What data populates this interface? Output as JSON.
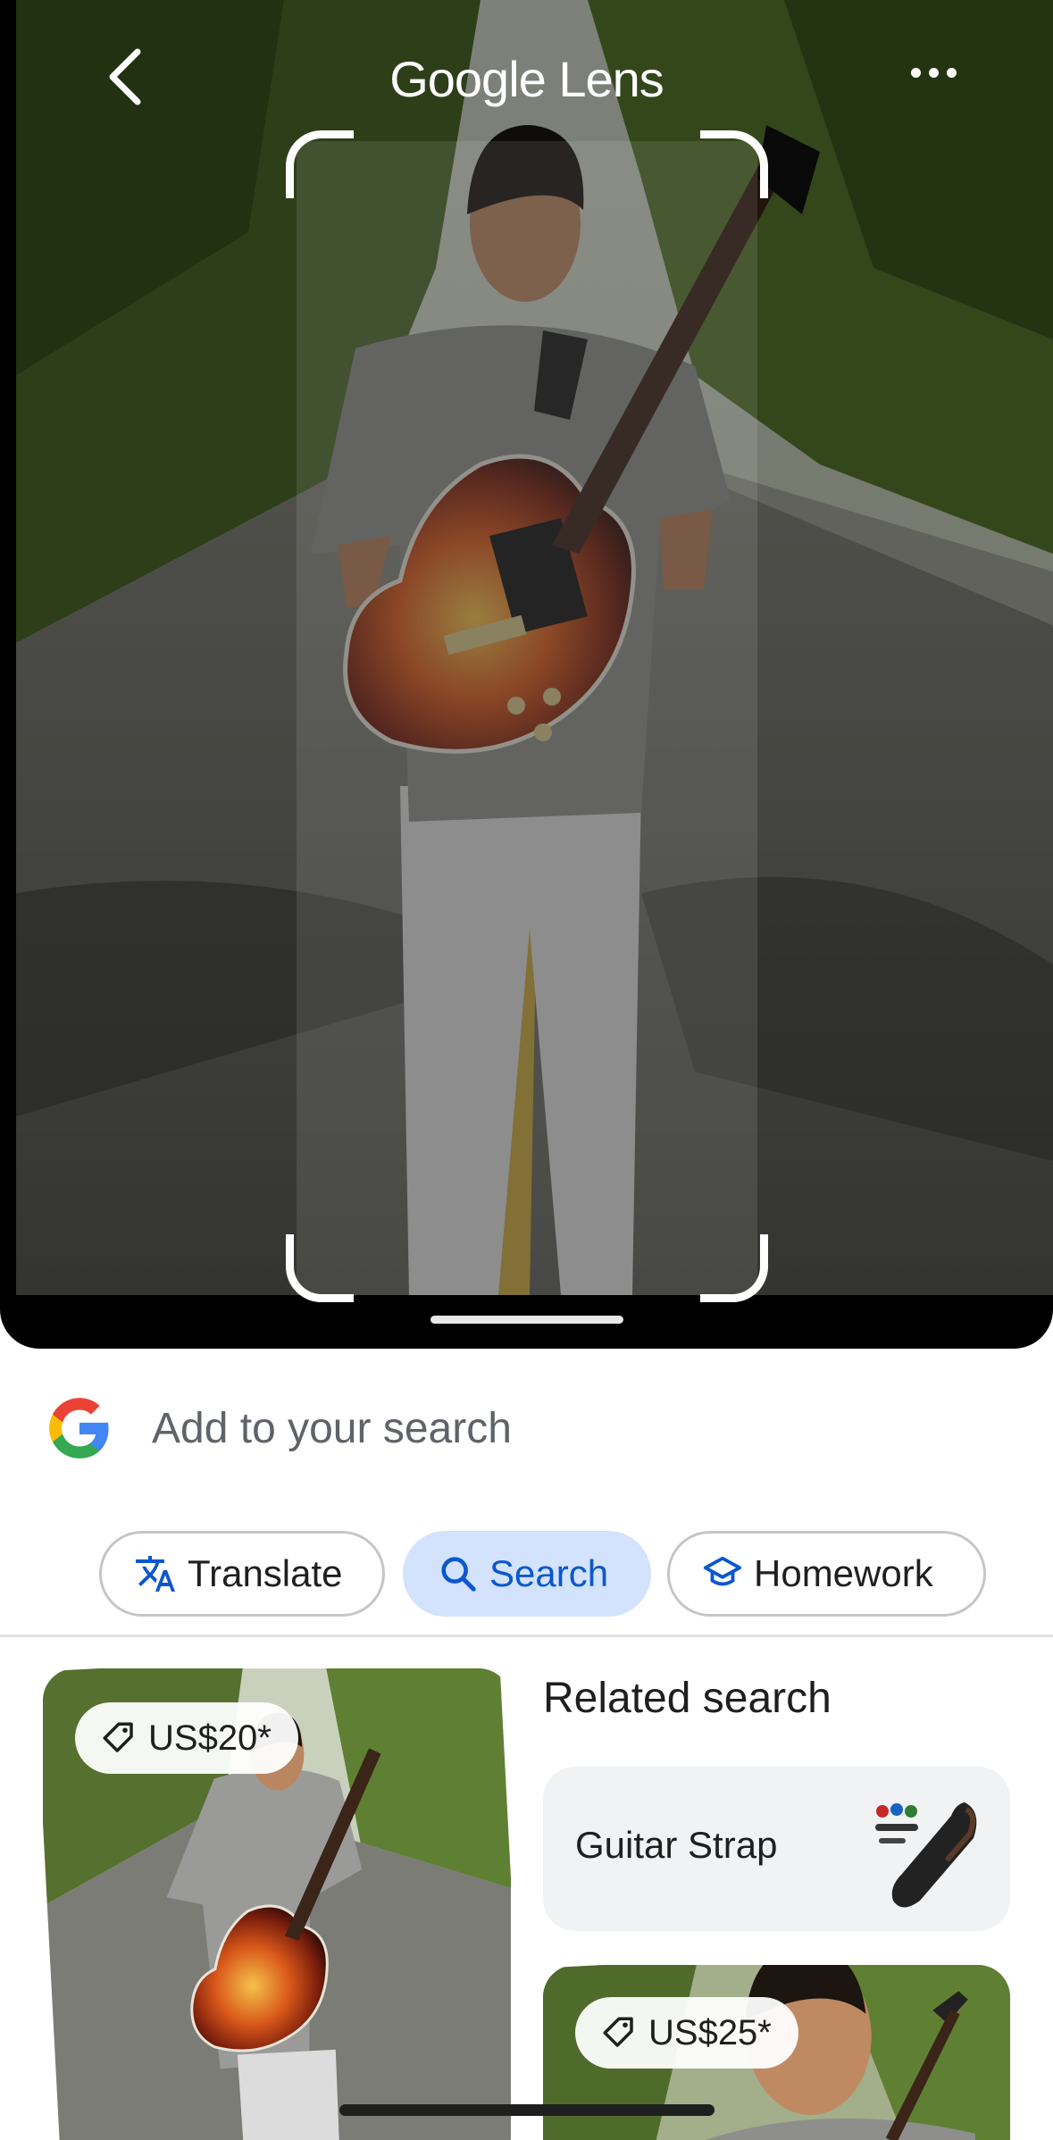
{
  "header": {
    "title": "Google Lens"
  },
  "icons": {
    "back": "back-arrow-icon",
    "more": "more-horizontal-icon",
    "google": "google-g-icon",
    "translate": "translate-icon",
    "search": "search-icon",
    "homework": "homework-icon",
    "price_tag": "price-tag-icon"
  },
  "search": {
    "placeholder": "Add to your search"
  },
  "chips": [
    {
      "label": "Translate",
      "active": false
    },
    {
      "label": "Search",
      "active": true
    },
    {
      "label": "Homework",
      "active": false
    }
  ],
  "results": {
    "main_card": {
      "price": "US$20*"
    },
    "related": {
      "title": "Related search",
      "items": [
        {
          "label": "Guitar Strap"
        }
      ]
    },
    "second_card": {
      "price": "US$25*"
    }
  },
  "colors": {
    "accent": "#0b57d0",
    "chip_active_bg": "#d3e3fd",
    "surface": "#f0f2f4"
  }
}
